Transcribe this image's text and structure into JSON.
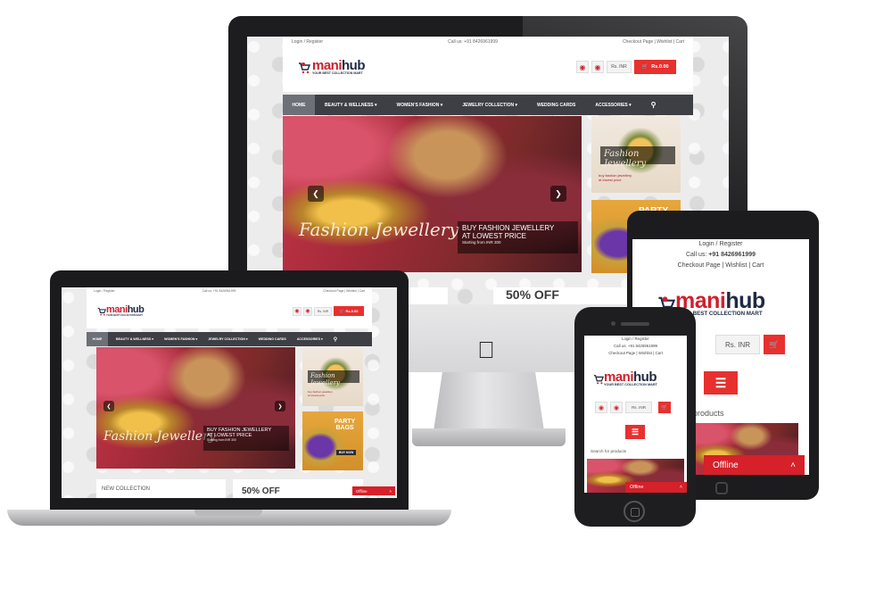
{
  "site": {
    "logo_a": "mani",
    "logo_b": "hub",
    "tagline": "YOUR BEST COLLECTION MART",
    "login": "Login / Register",
    "call": "Call us: +91 8426961999",
    "checkout": "Checkout Page",
    "wishlist": "Wishlist",
    "cart": "Cart",
    "currency": "Rs. INR",
    "cart_total": "Rs.0.00",
    "cart_count": "0",
    "search_placeholder": "Search for products",
    "offline": "Offline",
    "brand_color": "#d1202d"
  },
  "nav": {
    "home": "HOME",
    "beauty": "BEAUTY & WELLNESS",
    "women": "WOMEN'S FASHION",
    "jewelry": "JEWELRY COLLECTION",
    "wedding": "WEDDING CARDS",
    "accessories": "ACCESSORIES"
  },
  "hero": {
    "script": "Fashion Jewellery",
    "line1": "BUY FASHION JEWELLERY",
    "line2": "AT LOWEST PRICE",
    "line3": "Starting from INR 300"
  },
  "side": {
    "script": "Fashion Jewellery",
    "sub1": "buy fashion jewellery",
    "sub2": "at lowest price",
    "party": "PARTY",
    "bags": "BAGS",
    "buy_now": "BUY NOW"
  },
  "promo": {
    "new_collection": "NEW COLLECTION",
    "off": "50% OFF"
  },
  "tablet": {
    "login": "Login / Register",
    "call_prefix": "Call us: ",
    "call_number": "+91 8426961999",
    "checkout": "Checkout Page",
    "wishlist": "Wishlist",
    "cart": "Cart",
    "currency": "Rs. INR",
    "products": "products",
    "offline": "Offline"
  },
  "phone": {
    "login": "Login / Register",
    "call": "Call us: +91 8426961999",
    "links": "Checkout Page  |  Wishlist  |  Cart",
    "currency": "Rs. INR",
    "search": "Search for products",
    "offline": "Offline"
  }
}
